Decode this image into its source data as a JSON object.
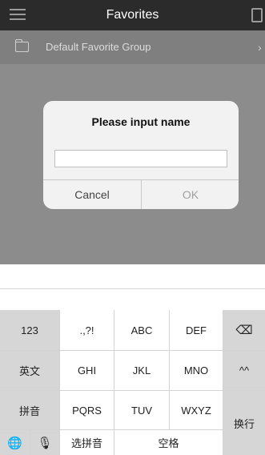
{
  "header": {
    "title": "Favorites"
  },
  "list": {
    "group_label": "Default Favorite Group",
    "chevron": "›"
  },
  "dialog": {
    "title": "Please input name",
    "input_value": "",
    "cancel_label": "Cancel",
    "ok_label": "OK"
  },
  "keyboard": {
    "row1": [
      "123",
      ".,?!",
      "ABC",
      "DEF"
    ],
    "row2": [
      "英文",
      "GHI",
      "JKL",
      "MNO",
      "^^"
    ],
    "row3": [
      "拼音",
      "PQRS",
      "TUV",
      "WXYZ"
    ],
    "row4": {
      "select_pinyin": "选拼音",
      "space": "空格"
    },
    "enter": "换行",
    "backspace_icon": "⌫",
    "globe_icon": "🌐",
    "mic_icon": "🎙"
  },
  "colors": {
    "topbar": "#2b2b2b",
    "overlay_content": "#8c8c8c",
    "dialog_bg": "#f2f2f2",
    "keyboard_bg": "#d3d3d3"
  }
}
